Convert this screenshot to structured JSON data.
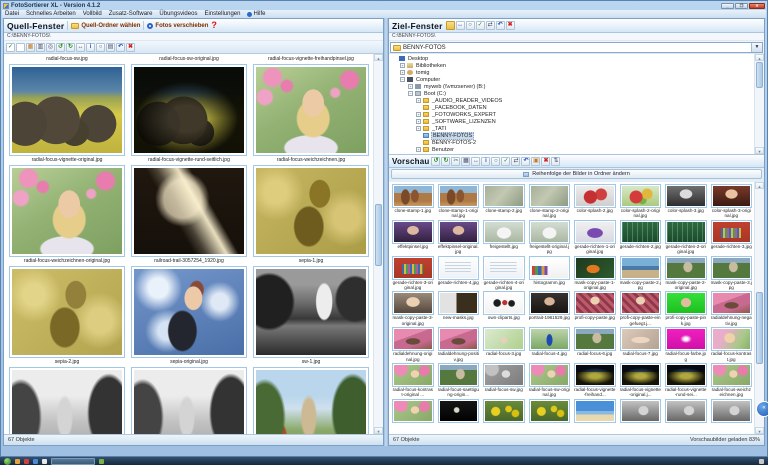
{
  "window": {
    "title": "FotoSortierer XL - Version 4.1.2"
  },
  "menu": {
    "items": [
      "Datei",
      "Schnelles Arbeiten",
      "Vollbild",
      "Zusatz-Software",
      "Übungsvideos",
      "Einstellungen",
      "Hilfe"
    ]
  },
  "colors": {
    "accent_blue": "#2a6ac8",
    "selection": "#c9d9ea",
    "thumb_border": "#a0c8e8",
    "danger_red": "#d02020"
  },
  "source_panel": {
    "title": "Quell-Fenster",
    "choose_folder_label": "Quell-Ordner wählen",
    "move_photos_label": "Fotos verschieben",
    "help_label": "?",
    "path": "C:\\BENNY-FOTOS\\",
    "toolbar_icons": [
      "checkbox-checked",
      "checkbox-empty",
      "people",
      "columns",
      "web",
      "rotate-ccw",
      "rotate-cw",
      "resize",
      "info",
      "zoom",
      "page",
      "undo",
      "delete"
    ],
    "top_captions": [
      "radial-focus-sw.jpg",
      "radial-focus-sw-original.jpg",
      "radial-focus-vignette-freihandpinsel.jpg"
    ],
    "rows": [
      {
        "cells": [
          {
            "label": "radial-focus-vignette-original.jpg",
            "art": "eleph"
          },
          {
            "label": "radial-focus-vignette-rund-seitlich.jpg",
            "art": "elephdark"
          },
          {
            "label": "radial-focus-weichzeichnen.jpg",
            "art": "blossomlg"
          }
        ]
      },
      {
        "cells": [
          {
            "label": "radial-focus-weichzeichnen-original.jpg",
            "art": "blossomlg"
          },
          {
            "label": "railroad-trail-3057254_1920.jpg",
            "art": "tunnel"
          },
          {
            "label": "sepia-1.jpg",
            "art": "sepia"
          }
        ]
      },
      {
        "cells": [
          {
            "label": "sepia-2.jpg",
            "art": "sepia2"
          },
          {
            "label": "sepia-original.jpg",
            "art": "womanblue"
          },
          {
            "label": "sw-1.jpg",
            "art": "bwcastle"
          }
        ]
      }
    ],
    "partial_row": [
      {
        "art": "bwgate"
      },
      {
        "art": "bwgate"
      },
      {
        "art": "colorgate"
      }
    ],
    "status": "67 Objekte"
  },
  "target_panel": {
    "title": "Ziel-Fenster",
    "header_icons": [
      "new-folder",
      "resize",
      "zoom",
      "check-page",
      "move",
      "undo",
      "delete"
    ],
    "path": "C:\\BENNY-FOTOS\\",
    "folder_select": "BENNY-FOTOS",
    "tree": [
      {
        "label": "Desktop",
        "icon": "desktop",
        "depth": 0,
        "expander": "none"
      },
      {
        "label": "Bibliotheken",
        "icon": "library",
        "depth": 1,
        "expander": "plus"
      },
      {
        "label": "tomig",
        "icon": "user",
        "depth": 1,
        "expander": "plus"
      },
      {
        "label": "Computer",
        "icon": "computer",
        "depth": 1,
        "expander": "minus"
      },
      {
        "label": "myweb (\\\\vmzserver) (B:)",
        "icon": "network-drive",
        "depth": 2,
        "expander": "plus"
      },
      {
        "label": "Boot (C:)",
        "icon": "drive",
        "depth": 2,
        "expander": "minus"
      },
      {
        "label": "_AUDIO_READER_VIDEOS",
        "icon": "folder",
        "depth": 3,
        "expander": "plus"
      },
      {
        "label": "_FACEBOOK_DATEN",
        "icon": "folder",
        "depth": 3,
        "expander": "none"
      },
      {
        "label": "_FOTOWORKS_EXPERT",
        "icon": "folder",
        "depth": 3,
        "expander": "plus"
      },
      {
        "label": "_SOFTWARE_LIZENZEN",
        "icon": "folder",
        "depth": 3,
        "expander": "plus"
      },
      {
        "label": "_TATI",
        "icon": "folder",
        "depth": 3,
        "expander": "plus"
      },
      {
        "label": "BENNY-FOTOS",
        "icon": "folder-open",
        "depth": 3,
        "expander": "none",
        "selected": true
      },
      {
        "label": "BENNY-FOTOS-2",
        "icon": "folder",
        "depth": 3,
        "expander": "none"
      },
      {
        "label": "Benutzer",
        "icon": "folder",
        "depth": 3,
        "expander": "plus"
      }
    ],
    "preview_title": "Vorschau",
    "preview_icons": [
      "rotate-ccw",
      "rotate-cw",
      "scissors",
      "grid",
      "resize",
      "info",
      "zoom",
      "check-page",
      "move",
      "undo",
      "picture",
      "delete",
      "reorder"
    ],
    "reorder_button": "Reihenfolge der Bilder in Ordner ändern",
    "thumbs": [
      {
        "label": "clone-stamp-1.jpg",
        "art": "rocks"
      },
      {
        "label": "clone-stamp-1-original.jpg",
        "art": "rocks"
      },
      {
        "label": "clone-stamp-2.jpg",
        "art": "blurgray"
      },
      {
        "label": "clone-stamp-2-original.jpg",
        "art": "blurgray"
      },
      {
        "label": "color-splash-2.jpg",
        "art": "apples"
      },
      {
        "label": "color-splash-2-original.jpg",
        "art": "apples2"
      },
      {
        "label": "color-splash-3.jpg",
        "art": "pgray"
      },
      {
        "label": "color-splash-3-original.jpg",
        "art": "pred"
      },
      {
        "label": "effektpinsel.jpg",
        "art": "ppurple"
      },
      {
        "label": "effektpinsel-original.jpg",
        "art": "ppurple"
      },
      {
        "label": "freigestellt.jpg",
        "art": "dog"
      },
      {
        "label": "freigestellt-original.jpg",
        "art": "dog"
      },
      {
        "label": "gerade-richten-1-original.jpg",
        "art": "pobj"
      },
      {
        "label": "gerade-richten-2.jpg",
        "art": "circuit"
      },
      {
        "label": "gerade-richten-2-original.jpg",
        "art": "circuit"
      },
      {
        "label": "gerade-richten-3.jpg",
        "art": "books"
      },
      {
        "label": "gerade-richten-3-original.jpg",
        "art": "books"
      },
      {
        "label": "gerade-richten-4.jpg",
        "art": "doc"
      },
      {
        "label": "gerade-richten-4-original.jpg",
        "art": "doc"
      },
      {
        "label": "histogramm.jpg",
        "art": "histo"
      },
      {
        "label": "mask-copy-paste-1-original.jpg",
        "art": "fish"
      },
      {
        "label": "mask-copy-paste-2.jpg",
        "art": "coast"
      },
      {
        "label": "mask-copy-paste-2-original.jpg",
        "art": "ctrees"
      },
      {
        "label": "mask-copy-paste-3.jpg",
        "art": "ctrees"
      },
      {
        "label": "mask-copy-paste-3-original.jpg",
        "art": "wface"
      },
      {
        "label": "new-masks.jpg",
        "art": "collage"
      },
      {
        "label": "own-cliparts.jpg",
        "art": "clipart"
      },
      {
        "label": "portrait-1961529.jpg",
        "art": "pdark"
      },
      {
        "label": "profi-copy-paste.jpg",
        "art": "fwoman"
      },
      {
        "label": "profi-copy-paste-eingefuegt.j...",
        "art": "fwoman"
      },
      {
        "label": "profi-copy-paste-pink.jpg",
        "art": "gflash"
      },
      {
        "label": "radialdehnung-negativ.jpg",
        "art": "bridge"
      },
      {
        "label": "radialdehnung-original.jpg",
        "art": "bridge"
      },
      {
        "label": "radialdehnung-positiv.jpg",
        "art": "bridge"
      },
      {
        "label": "radial-focus-3.jpg",
        "art": "bfield"
      },
      {
        "label": "radial-focus-4.jpg",
        "art": "peacock"
      },
      {
        "label": "radial-focus-6.jpg",
        "art": "ctrees"
      },
      {
        "label": "radial-focus-7.jpg",
        "art": "lying"
      },
      {
        "label": "radial-focus-farbe.jpg",
        "art": "magenta"
      },
      {
        "label": "radial-focus-kontrast.jpg",
        "art": "blonde"
      },
      {
        "label": "radial-focus-kontrast-original ...",
        "art": "bgirl"
      },
      {
        "label": "radial-focus-saettigung-origin...",
        "art": "ctrees"
      },
      {
        "label": "radial-focus-sw.jpg",
        "art": "bgray"
      },
      {
        "label": "radial-focus-sw-original.jpg",
        "art": "bgirl"
      },
      {
        "label": "radial-focus-vignette-freihand...",
        "art": "deleph"
      },
      {
        "label": "radial-focus-vignette-original.j...",
        "art": "deleph"
      },
      {
        "label": "radial-focus-vignette-rund-sei...",
        "art": "deleph"
      },
      {
        "label": "radial-focus-weichzeichnen.jpg",
        "art": "bgirl"
      }
    ],
    "partial_thumbs": [
      {
        "art": "bgirl"
      },
      {
        "art": "moon"
      },
      {
        "art": "yellowfl"
      },
      {
        "art": "yellowfl"
      },
      {
        "art": "beach"
      },
      {
        "art": "gcastle"
      },
      {
        "art": "gcastle"
      },
      {
        "art": "gcastle"
      }
    ],
    "status_left": "67 Objekte",
    "status_right": "Vorschaubilder geladen 83%"
  }
}
